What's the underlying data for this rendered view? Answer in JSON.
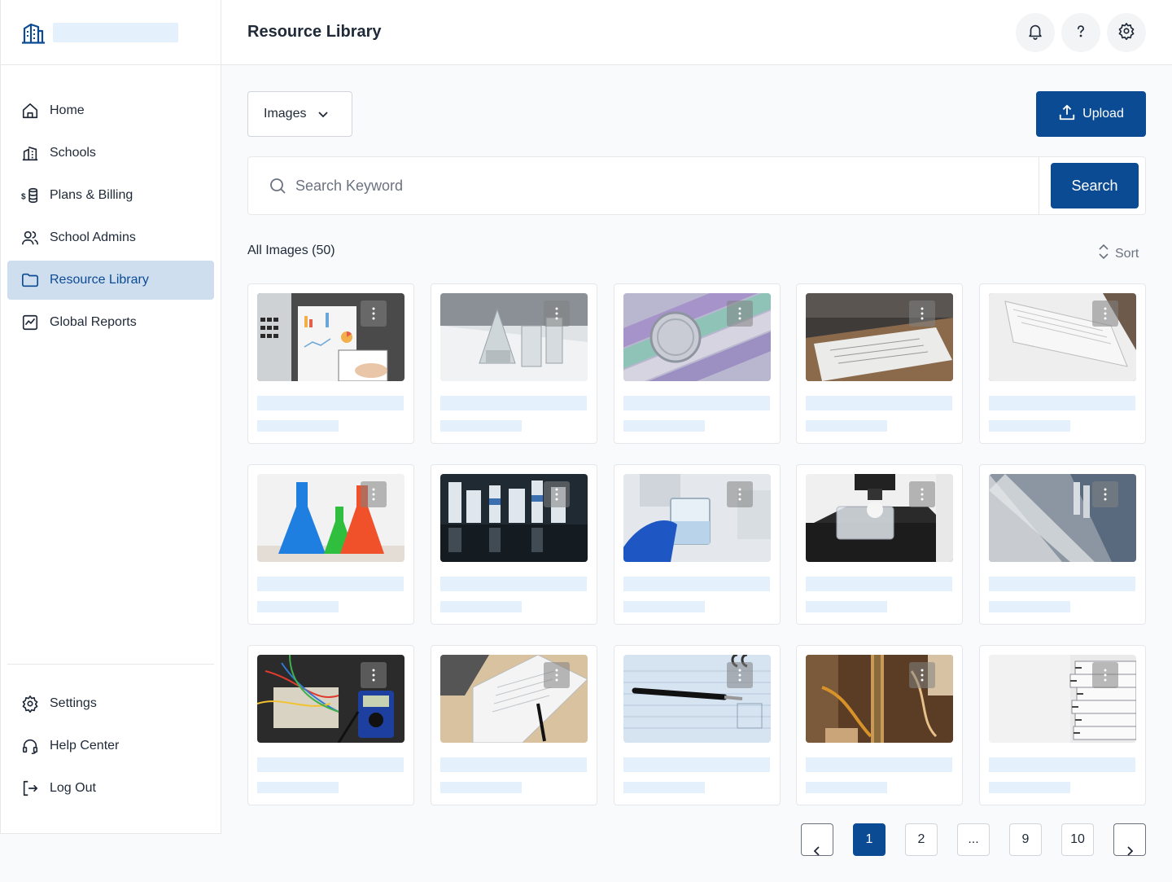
{
  "colors": {
    "primary": "#0b4b94",
    "active_bg": "#cfdeee",
    "placeholder": "#e4f0fc"
  },
  "sidebar": {
    "logo_icon": "building-icon",
    "items": [
      {
        "label": "Home",
        "icon": "home-icon"
      },
      {
        "label": "Schools",
        "icon": "school-building-icon"
      },
      {
        "label": "Plans & Billing",
        "icon": "coins-dollar-icon"
      },
      {
        "label": "School Admins",
        "icon": "users-icon"
      },
      {
        "label": "Resource Library",
        "icon": "folder-icon",
        "active": true
      },
      {
        "label": "Global Reports",
        "icon": "chart-icon"
      }
    ],
    "bottom_items": [
      {
        "label": "Settings",
        "icon": "gear-icon"
      },
      {
        "label": "Help Center",
        "icon": "headset-icon"
      },
      {
        "label": "Log Out",
        "icon": "logout-icon"
      }
    ]
  },
  "header": {
    "title": "Resource Library",
    "actions": [
      "bell-icon",
      "help-icon",
      "gear-icon"
    ]
  },
  "toolbar": {
    "filter_value": "Images",
    "upload_label": "Upload"
  },
  "search": {
    "placeholder": "Search Keyword",
    "button_label": "Search"
  },
  "list": {
    "count_label": "All Images (50)",
    "sort_label": "Sort"
  },
  "images": [
    "laptop-charts-notebook",
    "lab-glassware-white",
    "periodic-table-dish",
    "document-stack-table",
    "paper-sheets-wood",
    "colored-flasks",
    "lab-bottles-reflection",
    "gloved-hand-beaker",
    "microscope-petri",
    "lab-equipment-blur",
    "circuit-board-multimeter",
    "laptop-form-pen",
    "notebook-pen",
    "lab-apparatus-tubes",
    "binders-stack"
  ],
  "pagination": {
    "pages": [
      "1",
      "2",
      "...",
      "9",
      "10"
    ],
    "current": "1"
  }
}
